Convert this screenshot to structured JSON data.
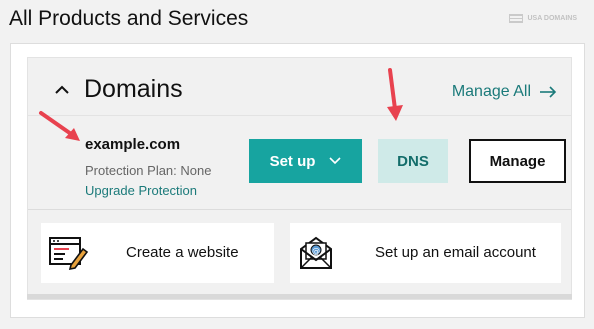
{
  "page": {
    "title": "All Products and Services",
    "watermark": "USA DOMAINS"
  },
  "section": {
    "title": "Domains",
    "manage_all_label": "Manage All",
    "collapse_icon": "chevron-up-icon",
    "manage_all_icon": "arrow-right-icon"
  },
  "domain": {
    "name": "example.com",
    "protection_plan": "Protection Plan: None",
    "upgrade_link": "Upgrade Protection"
  },
  "actions": {
    "setup_label": "Set up",
    "dns_label": "DNS",
    "manage_label": "Manage"
  },
  "tiles": [
    {
      "label": "Create a website",
      "icon": "website-editor-icon"
    },
    {
      "label": "Set up an email account",
      "icon": "email-envelope-icon"
    }
  ],
  "colors": {
    "accent_teal": "#17a4a0",
    "link_teal": "#1b7a7a",
    "dns_bg": "#cfeae8",
    "annotation_arrow": "#e8424f"
  }
}
